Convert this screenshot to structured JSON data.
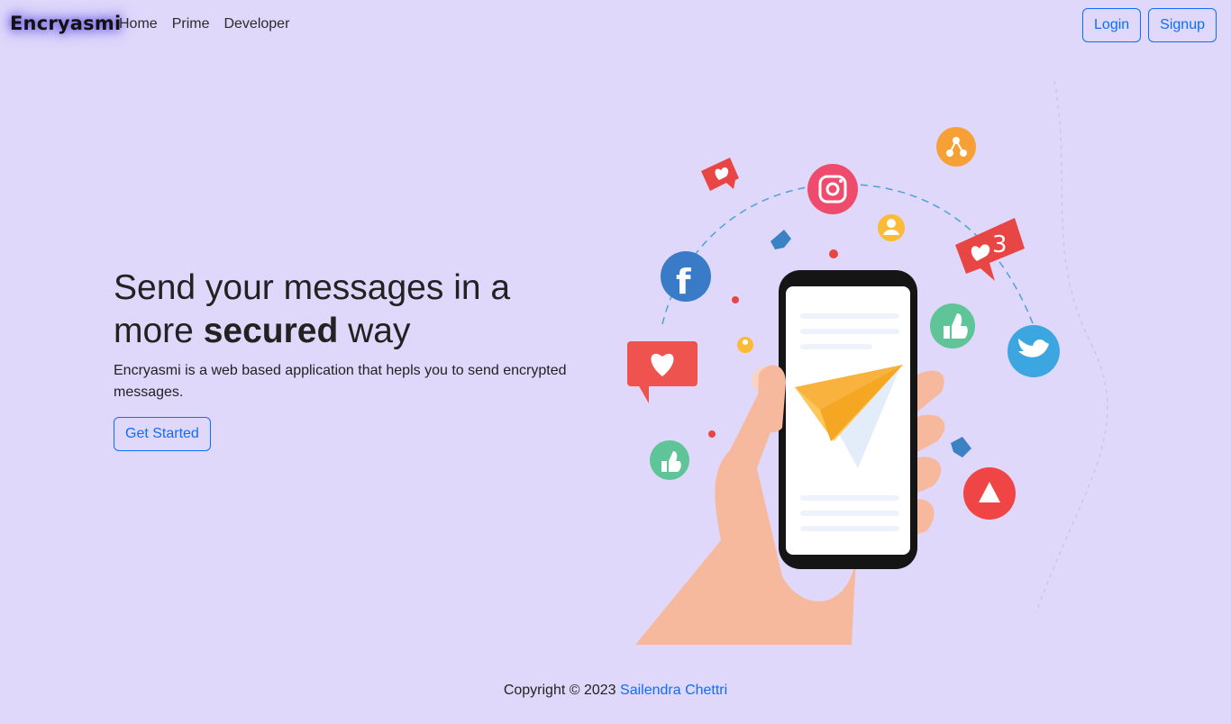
{
  "nav": {
    "brand": "Encryasmi",
    "links": [
      "Home",
      "Prime",
      "Developer"
    ],
    "login_label": "Login",
    "signup_label": "Signup"
  },
  "hero": {
    "title_part1": "Send your messages in a more ",
    "title_bold": "secured",
    "title_part2": " way",
    "subtitle": "Encryasmi is a web based application that hepls you to send encrypted messages.",
    "cta_label": "Get Started"
  },
  "illustration": {
    "badge_count": "3",
    "icons": [
      "share-icon",
      "heart-bubble-icon",
      "instagram-icon",
      "user-icon",
      "facebook-icon",
      "twitter-icon",
      "like-icon",
      "youtube-icon",
      "paper-plane-icon"
    ]
  },
  "footer": {
    "copyright": "Copyright © 2023",
    "author": "Sailendra Chettri"
  },
  "colors": {
    "background": "#dfd8fa",
    "accent": "#0d6efd"
  }
}
